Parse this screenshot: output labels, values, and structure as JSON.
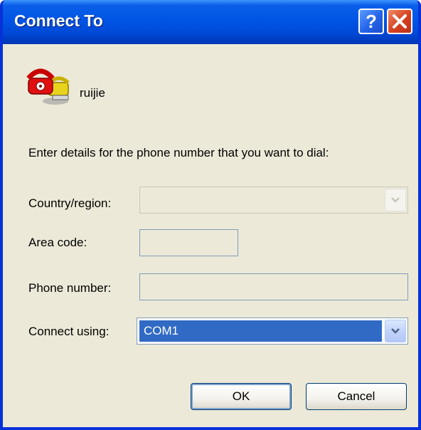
{
  "window": {
    "title": "Connect To"
  },
  "title_buttons": {
    "help": "?"
  },
  "connection": {
    "name": "ruijie",
    "icon": "telephone-icon"
  },
  "instruction": "Enter details for the phone number that you want to dial:",
  "fields": {
    "country": {
      "label": "Country/region:",
      "value": "",
      "enabled": false
    },
    "area_code": {
      "label": "Area code:",
      "value": "",
      "enabled": false
    },
    "phone_number": {
      "label": "Phone number:",
      "value": "",
      "enabled": false
    },
    "connect_using": {
      "label": "Connect using:",
      "value": "COM1",
      "enabled": true
    }
  },
  "buttons": {
    "ok": "OK",
    "cancel": "Cancel"
  },
  "colors": {
    "title_bar": "#0055e5",
    "dialog_bg": "#ece9d8",
    "selection": "#316ac5",
    "close_button": "#d6401f"
  }
}
